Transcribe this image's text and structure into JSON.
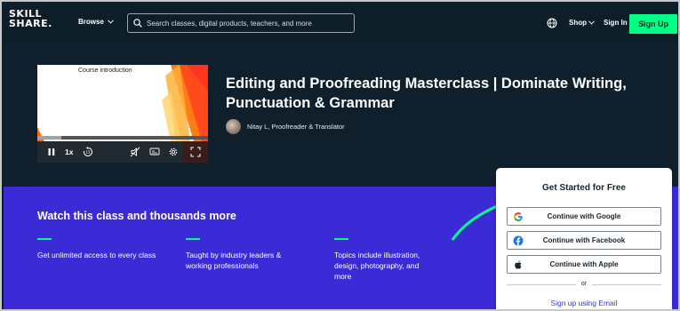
{
  "nav": {
    "logo_line1": "SKILL",
    "logo_line2": "SHARE.",
    "browse_label": "Browse",
    "search_placeholder": "Search classes, digital products, teachers, and more",
    "shop_label": "Shop",
    "signin_label": "Sign In",
    "signup_label": "Sign Up"
  },
  "video": {
    "slide_title": "Course introduction",
    "speed_label": "1x",
    "progress": 0.14
  },
  "course": {
    "title": "Editing and Proofreading Masterclass | Dominate Writing, Punctuation & Grammar",
    "author": "Nitay L, Proofreader & Translator"
  },
  "promo": {
    "heading": "Watch this class and thousands more",
    "features": [
      "Get unlimited access to every class",
      "Taught by industry leaders & working professionals",
      "Topics include illustration, design, photography, and more"
    ]
  },
  "signup_card": {
    "title": "Get Started for Free",
    "google_label": "Continue with Google",
    "facebook_label": "Continue with Facebook",
    "apple_label": "Continue with Apple",
    "or_label": "or",
    "email_label": "Sign up using Email"
  },
  "colors": {
    "nav_bg": "#0d1e29",
    "accent_green": "#00ff84",
    "promo_purple": "#3b2bd6",
    "link_blue": "#2f3fd1"
  }
}
